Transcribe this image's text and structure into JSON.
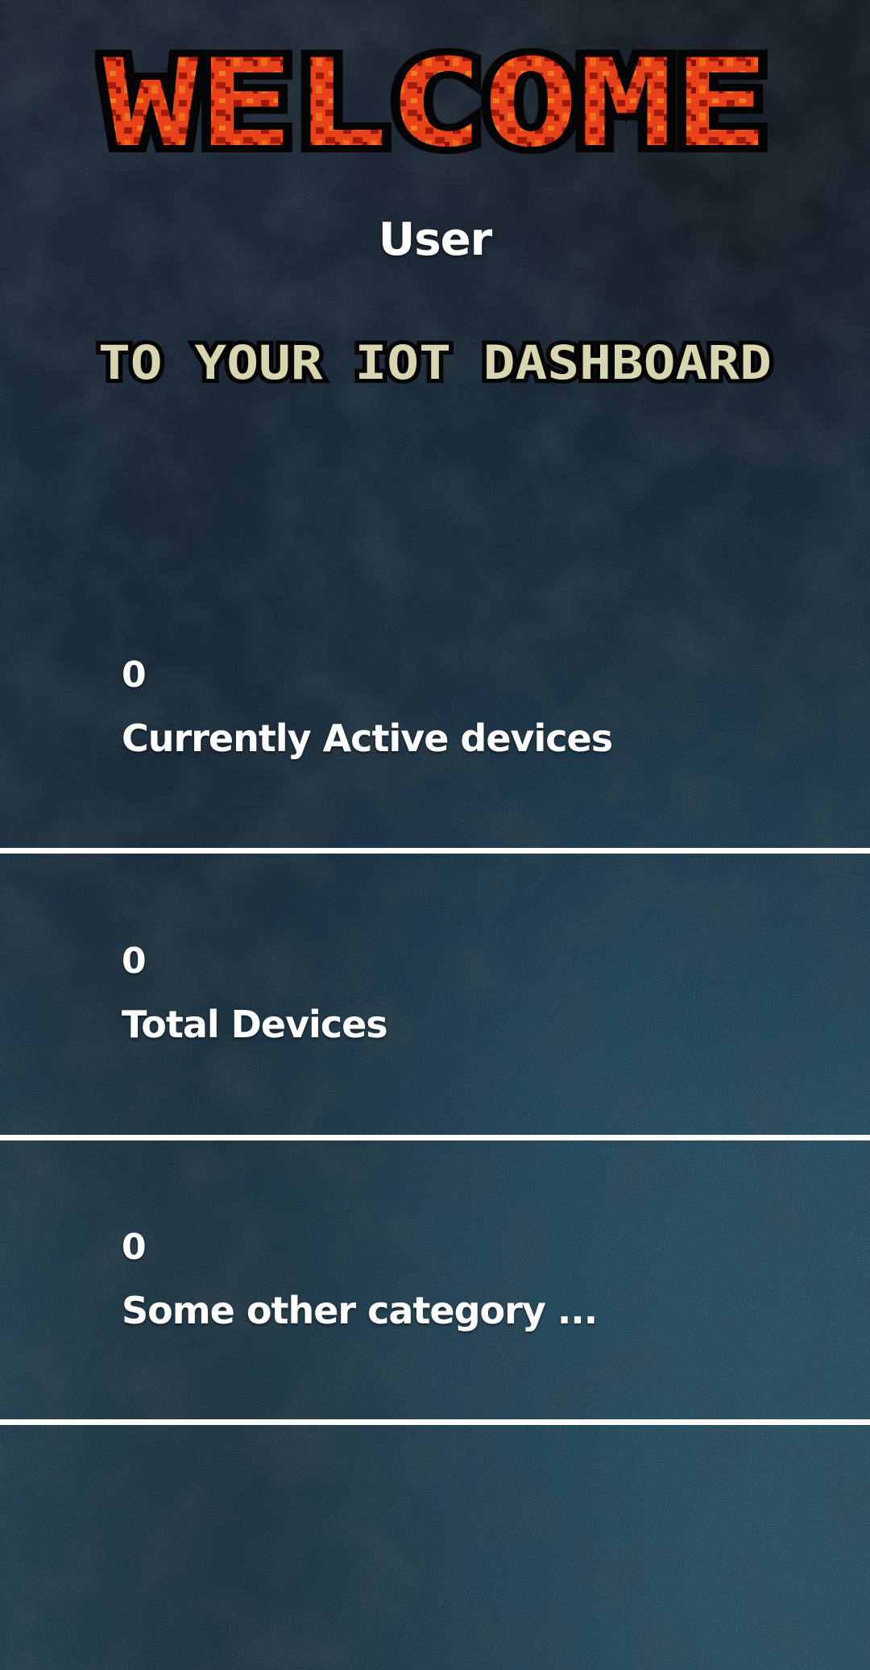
{
  "header": {
    "welcome_text": "WELCOME",
    "user_name": "User",
    "subtitle": "TO YOUR IOT DASHBOARD"
  },
  "colors": {
    "welcome_fill": "#e8421a",
    "welcome_dark": "#8a1406",
    "subtitle_fill": "#d8d6b0",
    "divider": "#ffffff",
    "text": "#ffffff"
  },
  "stats": [
    {
      "value": "0",
      "label": "Currently Active devices"
    },
    {
      "value": "0",
      "label": "Total Devices"
    },
    {
      "value": "0",
      "label": "Some other category ..."
    }
  ]
}
